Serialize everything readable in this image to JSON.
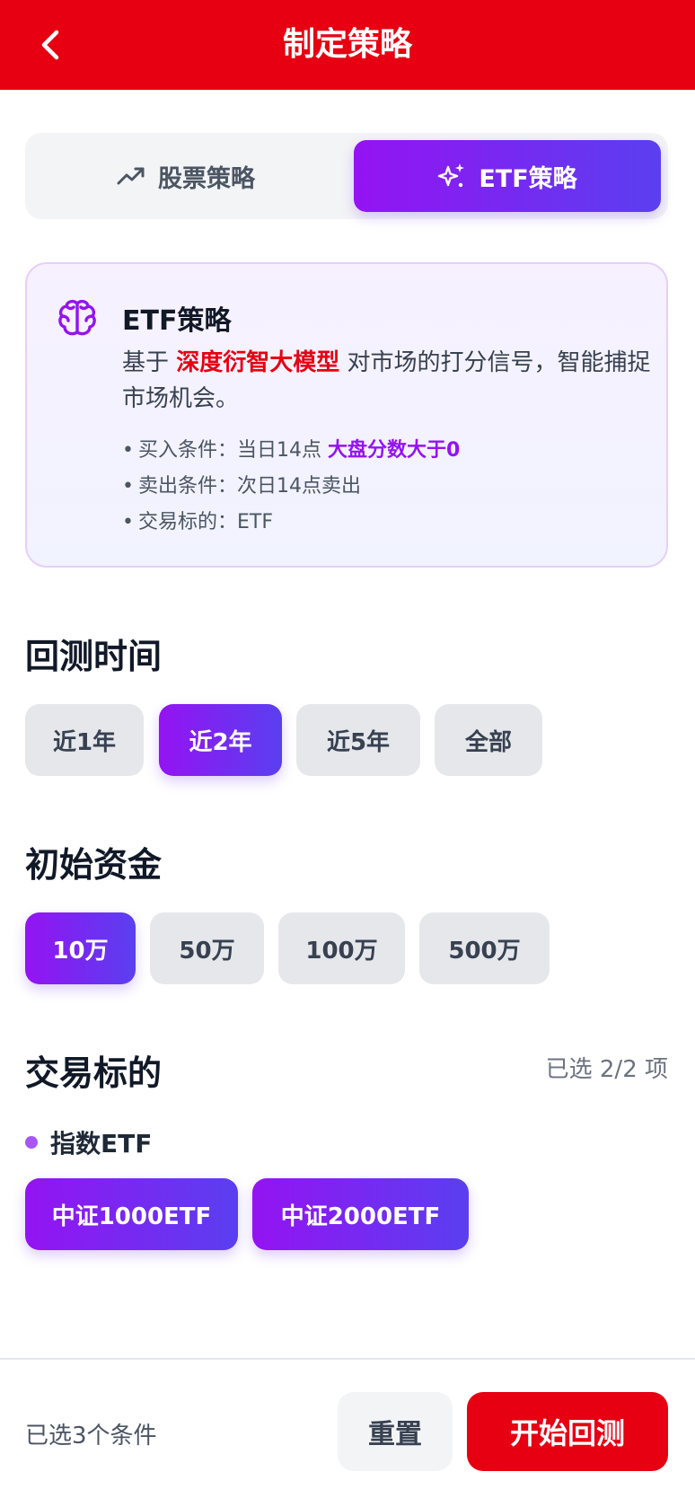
{
  "header": {
    "title": "制定策略",
    "back_icon": "chevron-left-icon",
    "bg_color": "#e60012"
  },
  "segment": {
    "tabs": [
      {
        "label": "股票策略",
        "icon": "trending-up-icon",
        "active": false
      },
      {
        "label": "ETF策略",
        "icon": "sparkles-icon",
        "active": true
      }
    ]
  },
  "info_card": {
    "icon": "brain-icon",
    "title": "ETF策略",
    "desc_prefix": "基于 ",
    "desc_highlight": "深度衍智大模型",
    "desc_suffix": " 对市场的打分信号，智能捕捉市场机会。",
    "bullets": [
      {
        "label": "买入条件：当日14点 ",
        "highlight": "大盘分数大于0"
      },
      {
        "label": "卖出条件：次日14点卖出",
        "highlight": ""
      },
      {
        "label": "交易标的：ETF",
        "highlight": ""
      }
    ]
  },
  "backtest_period": {
    "title": "回测时间",
    "options": [
      {
        "label": "近1年",
        "active": false
      },
      {
        "label": "近2年",
        "active": true
      },
      {
        "label": "近5年",
        "active": false
      },
      {
        "label": "全部",
        "active": false
      }
    ]
  },
  "initial_capital": {
    "title": "初始资金",
    "options": [
      {
        "label": "10万",
        "active": true
      },
      {
        "label": "50万",
        "active": false
      },
      {
        "label": "100万",
        "active": false
      },
      {
        "label": "500万",
        "active": false
      }
    ]
  },
  "trade_target": {
    "title": "交易标的",
    "selected_text": "已选 2/2 项",
    "group_label": "指数ETF",
    "options": [
      {
        "label": "中证1000ETF",
        "active": true
      },
      {
        "label": "中证2000ETF",
        "active": true
      }
    ]
  },
  "footer": {
    "summary": "已选3个条件",
    "reset_label": "重置",
    "start_label": "开始回测"
  },
  "colors": {
    "brand_red": "#e60012",
    "accent_purple": "#9413f2",
    "accent_indigo": "#5a3ff0"
  }
}
